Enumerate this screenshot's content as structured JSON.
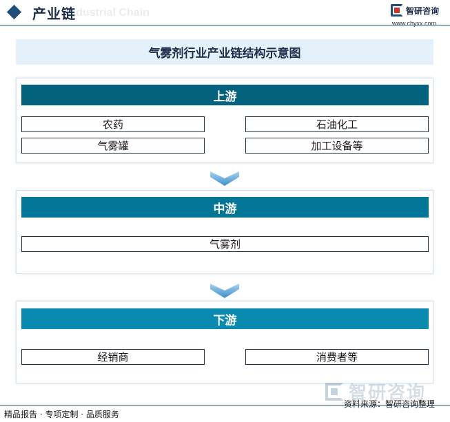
{
  "header": {
    "title": "产业链",
    "watermark": "Industrial Chain",
    "logo_text": "智研咨询",
    "url": "www.chyxx.com"
  },
  "diagram": {
    "title": "气雾剂行业产业链结构示意图",
    "stages": [
      {
        "label": "上游",
        "color": "#03637f",
        "items": [
          "农药",
          "石油化工",
          "气雾罐",
          "加工设备等"
        ]
      },
      {
        "label": "中游",
        "color": "#037596",
        "items": [
          "气雾剂"
        ]
      },
      {
        "label": "下游",
        "color": "#0b8ab0",
        "items": [
          "经销商",
          "消费者等"
        ]
      }
    ],
    "arrow_color": "#5aa8d8"
  },
  "footer": {
    "left": "精品报告 · 专项定制 · 品质服务",
    "source": "资料来源：智研咨询整理",
    "watermark": "智研咨询"
  }
}
